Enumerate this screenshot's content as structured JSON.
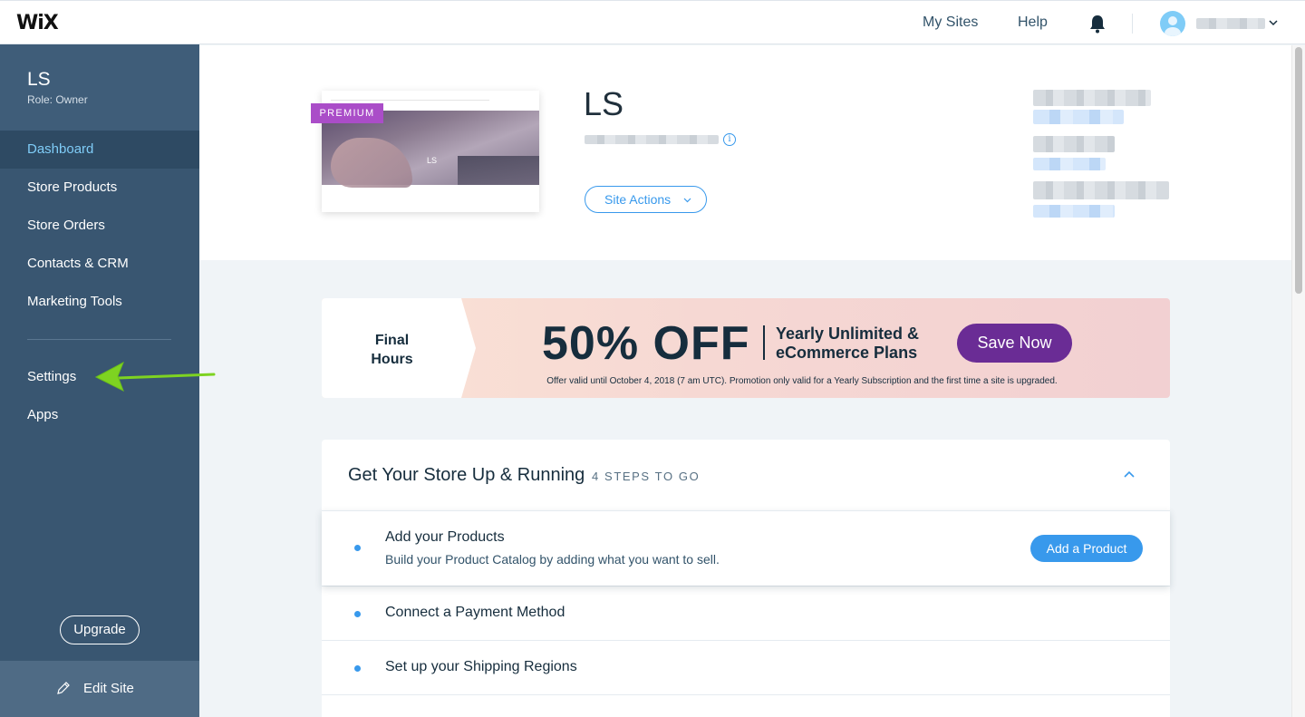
{
  "topbar": {
    "logo": "WiX",
    "my_sites": "My Sites",
    "help": "Help",
    "notifications_icon": "bell-icon",
    "account_menu_icon": "chevron-down-icon"
  },
  "sidebar": {
    "site_name": "LS",
    "role": "Role: Owner",
    "items": [
      {
        "label": "Dashboard",
        "active": true
      },
      {
        "label": "Store Products"
      },
      {
        "label": "Store Orders"
      },
      {
        "label": "Contacts & CRM"
      },
      {
        "label": "Marketing Tools"
      },
      {
        "label": "Settings"
      },
      {
        "label": "Apps"
      }
    ],
    "upgrade_label": "Upgrade",
    "edit_site_label": "Edit Site",
    "edit_icon": "pencil-icon"
  },
  "site_header": {
    "thumbnail_text": "LS",
    "badge": "PREMIUM",
    "site_title": "LS",
    "info_icon": "i",
    "site_actions_label": "Site Actions",
    "site_actions_icon": "chevron-down-icon"
  },
  "promo": {
    "left_text": "Final Hours",
    "headline": "50% OFF",
    "plans": "Yearly Unlimited & eCommerce Plans",
    "cta": "Save Now",
    "fine_print": "Offer valid until October 4, 2018 (7 am UTC). Promotion only valid for a Yearly Subscription and the first time a site is upgraded."
  },
  "steps": {
    "title": "Get Your Store Up & Running",
    "count": "4 STEPS TO GO",
    "collapse_icon": "chevron-up-icon",
    "items": [
      {
        "label": "Add your Products",
        "description": "Build your Product Catalog by adding what you want to sell.",
        "action": "Add a Product"
      },
      {
        "label": "Connect a Payment Method"
      },
      {
        "label": "Set up your Shipping Regions"
      }
    ]
  },
  "colors": {
    "sidebar_bg": "#395671",
    "accent_blue": "#3899ec",
    "premium_purple": "#aa4dc8",
    "cta_purple": "#6a2c95",
    "annotation_arrow": "#7ed321"
  }
}
